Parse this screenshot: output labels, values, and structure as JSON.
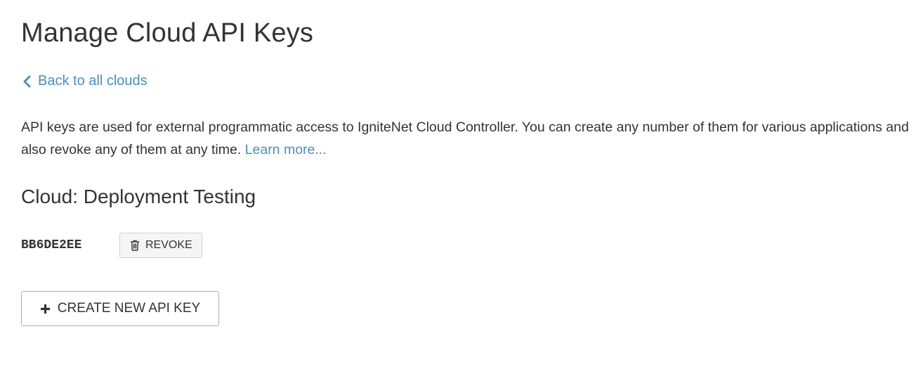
{
  "page": {
    "title": "Manage Cloud API Keys"
  },
  "nav": {
    "back_label": "Back to all clouds",
    "back_icon": "chevron-left-icon"
  },
  "description": {
    "text": "API keys are used for external programmatic access to IgniteNet Cloud Controller. You can create any number of them for various applications and also revoke any of them at any time. ",
    "link_label": "Learn more..."
  },
  "cloud": {
    "heading": "Cloud: Deployment Testing",
    "keys": [
      {
        "key": "BB6DE2EE",
        "revoke_label": "REVOKE",
        "revoke_icon": "trash-icon"
      }
    ]
  },
  "actions": {
    "create_label": "CREATE NEW API KEY",
    "create_icon": "plus-icon"
  },
  "colors": {
    "link": "#4a90b8",
    "text": "#333333",
    "button_border": "#adadad"
  }
}
